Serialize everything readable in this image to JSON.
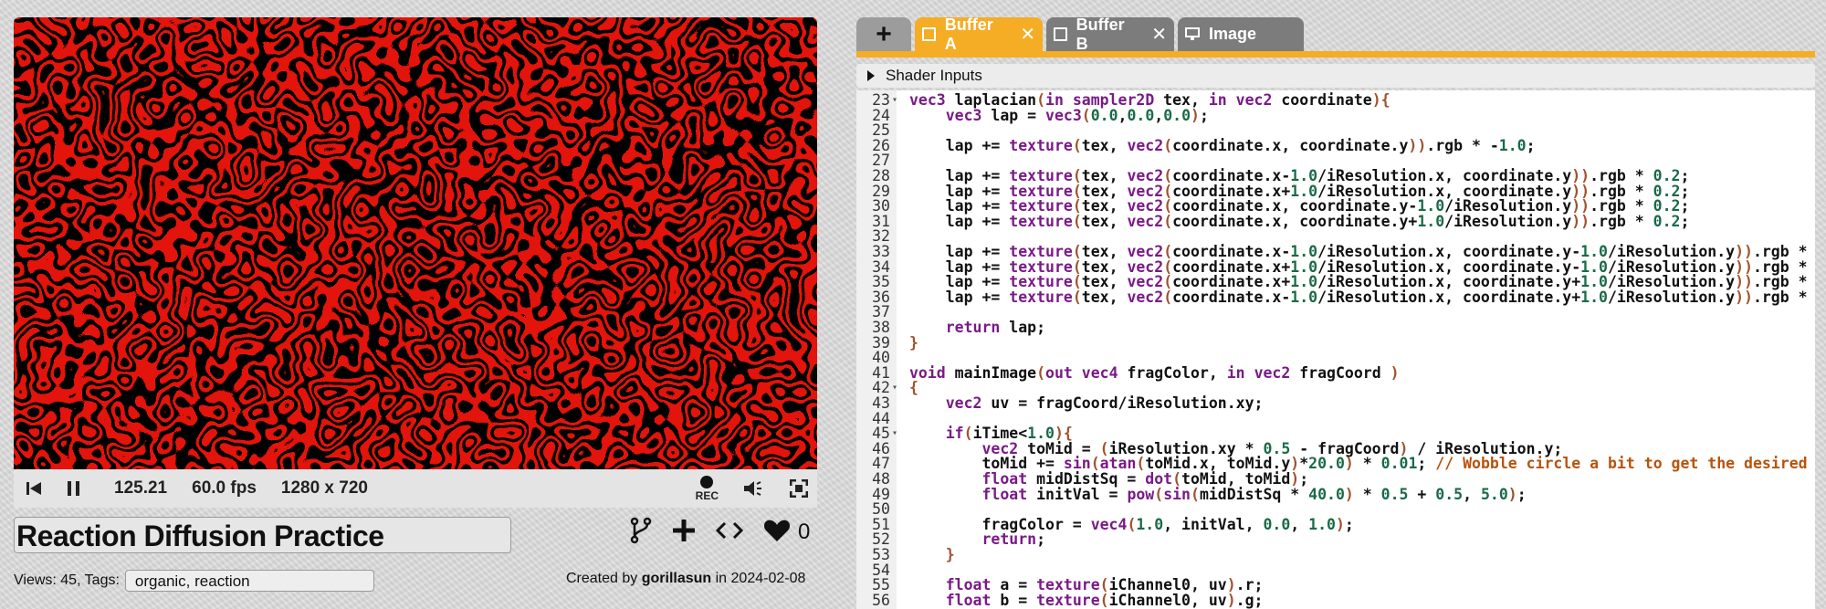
{
  "player": {
    "time": "125.21",
    "fps": "60.0 fps",
    "resolution": "1280 x 720",
    "rec_label": "REC"
  },
  "shader": {
    "title": "Reaction Diffusion Practice",
    "views_tags_label": "Views: 45, Tags:",
    "tags": "organic, reaction",
    "created_prefix": "Created by",
    "author": "gorillasun",
    "created_in": "in 2024-02-08",
    "likes": "0"
  },
  "tabs": [
    {
      "label": "Buffer A",
      "active": true,
      "closable": true
    },
    {
      "label": "Buffer B",
      "active": false,
      "closable": true
    },
    {
      "label": "Image",
      "active": false,
      "closable": false
    }
  ],
  "shader_inputs_label": "Shader Inputs",
  "colors": {
    "accent": "#f4ad25",
    "pattern_red": "#e2140c",
    "pattern_green": "#4c8a1e"
  },
  "code_lines": [
    {
      "n": "23",
      "fold": true,
      "text": "vec3 laplacian(in sampler2D tex, in vec2 coordinate){"
    },
    {
      "n": "24",
      "text": "    vec3 lap = vec3(0.0,0.0,0.0);"
    },
    {
      "n": "25",
      "text": ""
    },
    {
      "n": "26",
      "text": "    lap += texture(tex, vec2(coordinate.x, coordinate.y)).rgb * -1.0;"
    },
    {
      "n": "27",
      "text": ""
    },
    {
      "n": "28",
      "text": "    lap += texture(tex, vec2(coordinate.x-1.0/iResolution.x, coordinate.y)).rgb * 0.2;"
    },
    {
      "n": "29",
      "text": "    lap += texture(tex, vec2(coordinate.x+1.0/iResolution.x, coordinate.y)).rgb * 0.2;"
    },
    {
      "n": "30",
      "text": "    lap += texture(tex, vec2(coordinate.x, coordinate.y-1.0/iResolution.y)).rgb * 0.2;"
    },
    {
      "n": "31",
      "text": "    lap += texture(tex, vec2(coordinate.x, coordinate.y+1.0/iResolution.y)).rgb * 0.2;"
    },
    {
      "n": "32",
      "text": ""
    },
    {
      "n": "33",
      "text": "    lap += texture(tex, vec2(coordinate.x-1.0/iResolution.x, coordinate.y-1.0/iResolution.y)).rgb *"
    },
    {
      "n": "34",
      "text": "    lap += texture(tex, vec2(coordinate.x+1.0/iResolution.x, coordinate.y-1.0/iResolution.y)).rgb *"
    },
    {
      "n": "35",
      "text": "    lap += texture(tex, vec2(coordinate.x+1.0/iResolution.x, coordinate.y+1.0/iResolution.y)).rgb *"
    },
    {
      "n": "36",
      "text": "    lap += texture(tex, vec2(coordinate.x-1.0/iResolution.x, coordinate.y+1.0/iResolution.y)).rgb *"
    },
    {
      "n": "37",
      "text": ""
    },
    {
      "n": "38",
      "text": "    return lap;"
    },
    {
      "n": "39",
      "text": "}"
    },
    {
      "n": "40",
      "text": ""
    },
    {
      "n": "41",
      "text": "void mainImage(out vec4 fragColor, in vec2 fragCoord )"
    },
    {
      "n": "42",
      "fold": true,
      "text": "{"
    },
    {
      "n": "43",
      "text": "    vec2 uv = fragCoord/iResolution.xy;"
    },
    {
      "n": "44",
      "text": ""
    },
    {
      "n": "45",
      "fold": true,
      "text": "    if(iTime<1.0){"
    },
    {
      "n": "46",
      "text": "        vec2 toMid = (iResolution.xy * 0.5 - fragCoord) / iResolution.y;"
    },
    {
      "n": "47",
      "text": "        toMid += sin(atan(toMid.x, toMid.y)*20.0) * 0.01; // Wobble circle a bit to get the desired"
    },
    {
      "n": "48",
      "text": "        float midDistSq = dot(toMid, toMid);"
    },
    {
      "n": "49",
      "text": "        float initVal = pow(sin(midDistSq * 40.0) * 0.5 + 0.5, 5.0);"
    },
    {
      "n": "50",
      "text": ""
    },
    {
      "n": "51",
      "text": "        fragColor = vec4(1.0, initVal, 0.0, 1.0);"
    },
    {
      "n": "52",
      "text": "        return;"
    },
    {
      "n": "53",
      "text": "    }"
    },
    {
      "n": "54",
      "text": ""
    },
    {
      "n": "55",
      "text": "    float a = texture(iChannel0, uv).r;"
    },
    {
      "n": "56",
      "text": "    float b = texture(iChannel0, uv).g;"
    }
  ]
}
